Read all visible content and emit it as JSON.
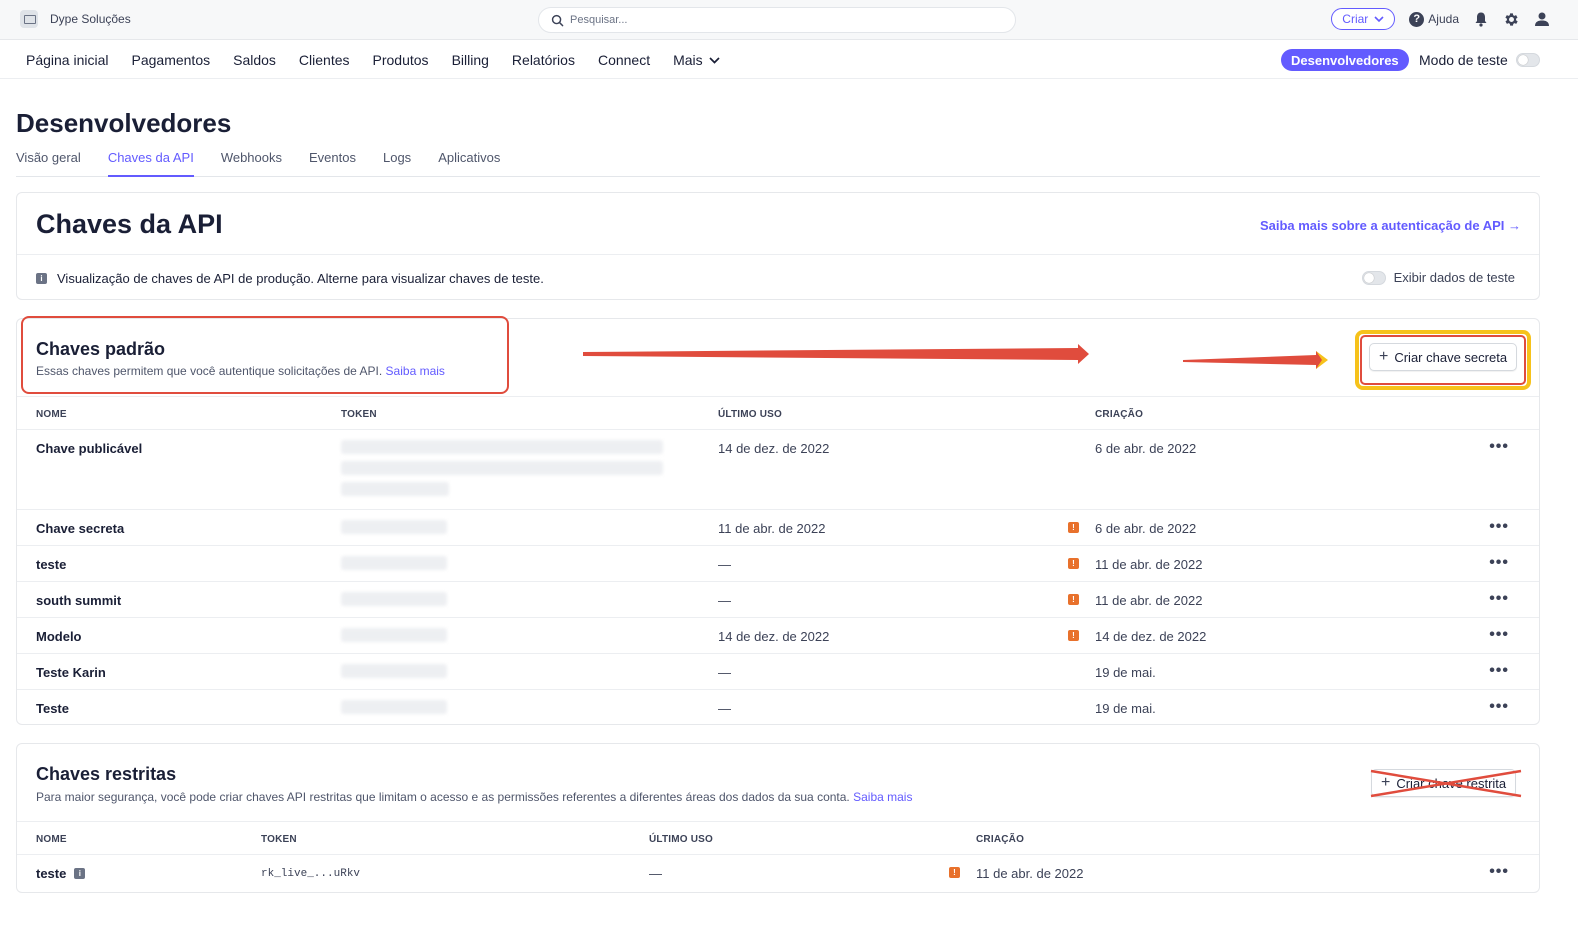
{
  "topbar": {
    "account_name": "Dype Soluções",
    "search_placeholder": "Pesquisar...",
    "create_label": "Criar",
    "help_label": "Ajuda"
  },
  "nav": {
    "items": [
      "Página inicial",
      "Pagamentos",
      "Saldos",
      "Clientes",
      "Produtos",
      "Billing",
      "Relatórios",
      "Connect",
      "Mais"
    ],
    "developers_label": "Desenvolvedores",
    "test_mode_label": "Modo de teste"
  },
  "page": {
    "title": "Desenvolvedores",
    "tabs": [
      "Visão geral",
      "Chaves da API",
      "Webhooks",
      "Eventos",
      "Logs",
      "Aplicativos"
    ],
    "active_tab": "Chaves da API"
  },
  "api_card": {
    "title": "Chaves da API",
    "auth_link": "Saiba mais sobre a autenticação de API →",
    "info_text": "Visualização de chaves de API de produção. Alterne para visualizar chaves de teste.",
    "show_test_label": "Exibir dados de teste"
  },
  "standard_keys": {
    "title": "Chaves padrão",
    "description": "Essas chaves permitem que você autentique solicitações de API.",
    "learn_more": "Saiba mais",
    "create_button": "Criar chave secreta",
    "columns": [
      "NOME",
      "TOKEN",
      "ÚLTIMO USO",
      "CRIAÇÃO"
    ],
    "rows": [
      {
        "name": "Chave publicável",
        "last_used": "14 de dez. de 2022",
        "created": "6 de abr. de 2022",
        "warn": false
      },
      {
        "name": "Chave secreta",
        "last_used": "11 de abr. de 2022",
        "created": "6 de abr. de 2022",
        "warn": true
      },
      {
        "name": "teste",
        "last_used": "—",
        "created": "11 de abr. de 2022",
        "warn": true
      },
      {
        "name": "south summit",
        "last_used": "—",
        "created": "11 de abr. de 2022",
        "warn": true
      },
      {
        "name": "Modelo",
        "last_used": "14 de dez. de 2022",
        "created": "14 de dez. de 2022",
        "warn": true
      },
      {
        "name": "Teste Karin",
        "last_used": "—",
        "created": "19 de mai.",
        "warn": false
      },
      {
        "name": "Teste",
        "last_used": "—",
        "created": "19 de mai.",
        "warn": false
      }
    ],
    "more_label": "•••"
  },
  "restricted_keys": {
    "title": "Chaves restritas",
    "description": "Para maior segurança, você pode criar chaves API restritas que limitam o acesso e as permissões referentes a diferentes áreas dos dados da sua conta.",
    "learn_more": "Saiba mais",
    "create_button": "Criar chave restrita",
    "columns": [
      "NOME",
      "TOKEN",
      "ÚLTIMO USO",
      "CRIAÇÃO"
    ],
    "rows": [
      {
        "name": "teste",
        "token": "rk_live_...uRkv",
        "last_used": "—",
        "created": "11 de abr. de 2022"
      }
    ],
    "more_label": "•••"
  },
  "colors": {
    "accent": "#635bff",
    "warning": "#e8712c",
    "annotation_red": "#e04c3d",
    "annotation_yellow": "#f6c21b"
  }
}
